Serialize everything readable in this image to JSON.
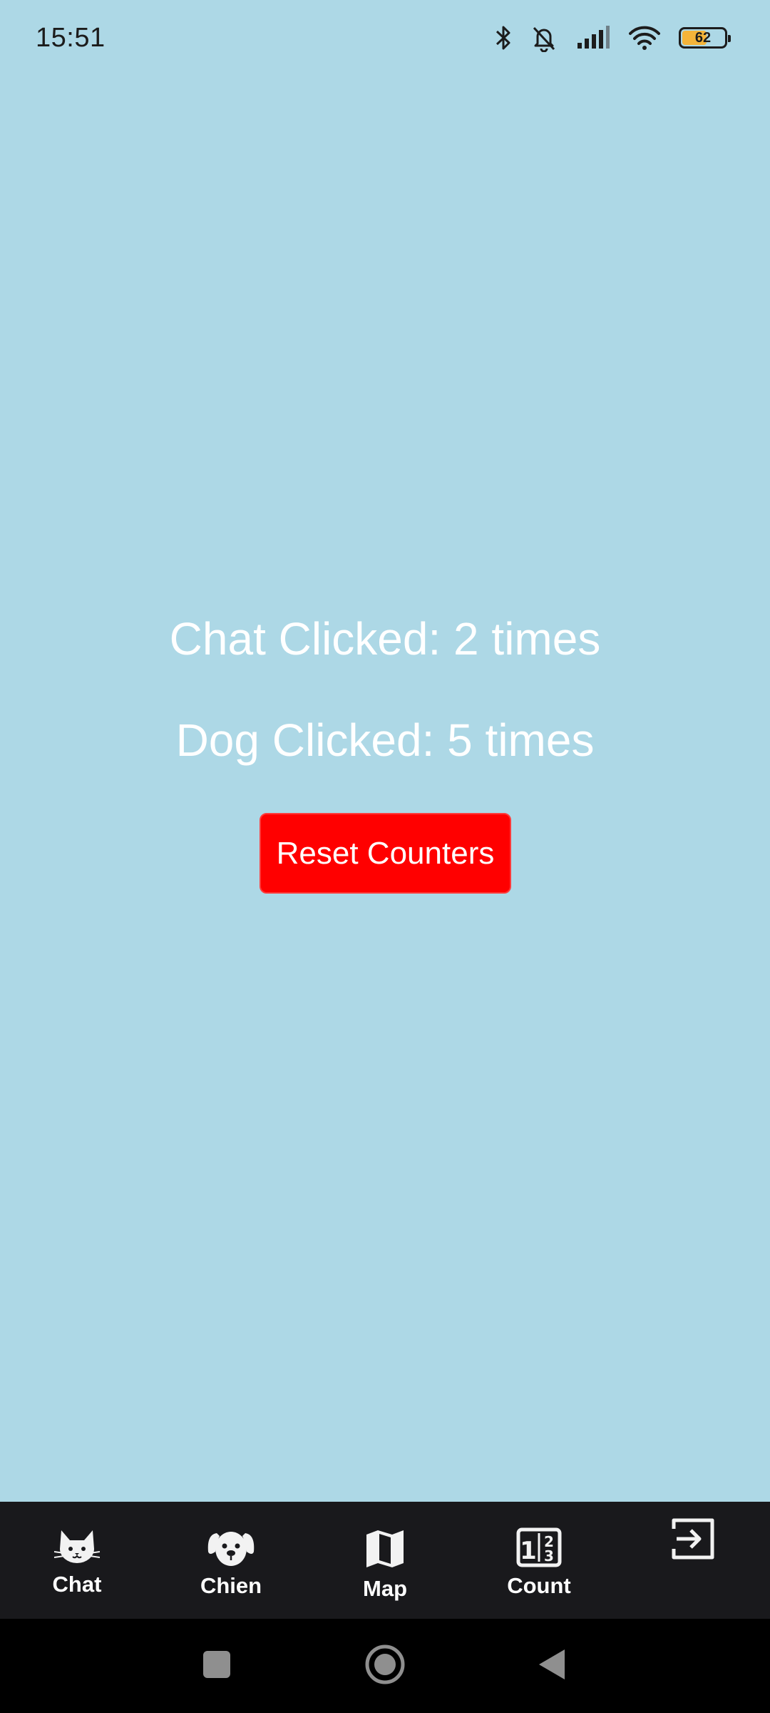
{
  "status_bar": {
    "time": "15:51",
    "battery_level": "62",
    "battery_fill_fraction": 0.62,
    "icons": [
      "bluetooth-icon",
      "bell-muted-icon",
      "signal-icon",
      "wifi-icon",
      "battery-icon"
    ]
  },
  "main": {
    "chat_counter_text": "Chat Clicked: 2 times",
    "dog_counter_text": "Dog Clicked: 5 times",
    "reset_button_label": "Reset Counters",
    "background_color": "#add8e6",
    "button_color": "#ff0000"
  },
  "tab_bar": {
    "tabs": [
      {
        "label": "Chat",
        "icon": "cat-icon"
      },
      {
        "label": "Chien",
        "icon": "dog-icon"
      },
      {
        "label": "Map",
        "icon": "map-icon"
      },
      {
        "label": "Count",
        "icon": "count-icon"
      },
      {
        "label": "",
        "icon": "logout-icon"
      }
    ],
    "background_color": "#19191c"
  },
  "nav_bar": {
    "buttons": [
      "recents-icon",
      "home-icon",
      "back-icon"
    ]
  }
}
